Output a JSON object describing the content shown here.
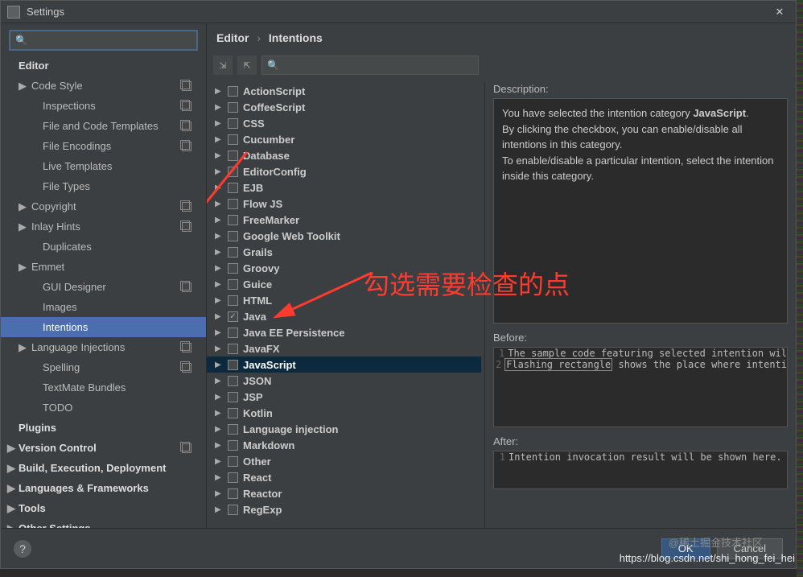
{
  "titlebar": {
    "title": "Settings"
  },
  "breadcrumb": {
    "a": "Editor",
    "b": "Intentions"
  },
  "sidebar": {
    "search_placeholder": "",
    "items": [
      {
        "label": "Editor",
        "lvl": 0,
        "bold": true,
        "arrow": ""
      },
      {
        "label": "Code Style",
        "lvl": 1,
        "arrow": "▶",
        "copy": true
      },
      {
        "label": "Inspections",
        "lvl": 2,
        "copy": true
      },
      {
        "label": "File and Code Templates",
        "lvl": 2,
        "copy": true
      },
      {
        "label": "File Encodings",
        "lvl": 2,
        "copy": true
      },
      {
        "label": "Live Templates",
        "lvl": 2
      },
      {
        "label": "File Types",
        "lvl": 2
      },
      {
        "label": "Copyright",
        "lvl": 1,
        "arrow": "▶",
        "copy": true
      },
      {
        "label": "Inlay Hints",
        "lvl": 1,
        "arrow": "▶",
        "copy": true
      },
      {
        "label": "Duplicates",
        "lvl": 2
      },
      {
        "label": "Emmet",
        "lvl": 1,
        "arrow": "▶"
      },
      {
        "label": "GUI Designer",
        "lvl": 2,
        "copy": true
      },
      {
        "label": "Images",
        "lvl": 2
      },
      {
        "label": "Intentions",
        "lvl": 2,
        "selected": true
      },
      {
        "label": "Language Injections",
        "lvl": 1,
        "arrow": "▶",
        "copy": true
      },
      {
        "label": "Spelling",
        "lvl": 2,
        "copy": true
      },
      {
        "label": "TextMate Bundles",
        "lvl": 2
      },
      {
        "label": "TODO",
        "lvl": 2
      },
      {
        "label": "Plugins",
        "lvl": 0,
        "bold": true
      },
      {
        "label": "Version Control",
        "lvl": 0,
        "bold": true,
        "arrow": "▶",
        "copy": true
      },
      {
        "label": "Build, Execution, Deployment",
        "lvl": 0,
        "bold": true,
        "arrow": "▶"
      },
      {
        "label": "Languages & Frameworks",
        "lvl": 0,
        "bold": true,
        "arrow": "▶"
      },
      {
        "label": "Tools",
        "lvl": 0,
        "bold": true,
        "arrow": "▶"
      },
      {
        "label": "Other Settings",
        "lvl": 0,
        "bold": true,
        "arrow": "▶"
      }
    ]
  },
  "intentions": [
    {
      "label": "ActionScript"
    },
    {
      "label": "CoffeeScript"
    },
    {
      "label": "CSS"
    },
    {
      "label": "Cucumber"
    },
    {
      "label": "Database"
    },
    {
      "label": "EditorConfig"
    },
    {
      "label": "EJB"
    },
    {
      "label": "Flow JS"
    },
    {
      "label": "FreeMarker"
    },
    {
      "label": "Google Web Toolkit"
    },
    {
      "label": "Grails"
    },
    {
      "label": "Groovy"
    },
    {
      "label": "Guice"
    },
    {
      "label": "HTML"
    },
    {
      "label": "Java",
      "checked": true
    },
    {
      "label": "Java EE Persistence"
    },
    {
      "label": "JavaFX"
    },
    {
      "label": "JavaScript",
      "sel": true
    },
    {
      "label": "JSON"
    },
    {
      "label": "JSP"
    },
    {
      "label": "Kotlin"
    },
    {
      "label": "Language injection"
    },
    {
      "label": "Markdown"
    },
    {
      "label": "Other"
    },
    {
      "label": "React"
    },
    {
      "label": "Reactor"
    },
    {
      "label": "RegExp"
    }
  ],
  "desc": {
    "label": "Description:",
    "line1a": "You have selected the intention category ",
    "line1b": "JavaScript",
    "line1c": ".",
    "line2": "By clicking the checkbox, you can enable/disable all intentions in this category.",
    "line3": "To enable/disable a particular intention, select the intention inside this category."
  },
  "before": {
    "label": "Before:",
    "l1": "The sample code featuring selected intention wil",
    "l2a": "Flashing rectangle",
    "l2b": " shows the place where intenti"
  },
  "after": {
    "label": "After:",
    "l1": "Intention invocation result will be shown here."
  },
  "footer": {
    "ok": "OK",
    "cancel": "Cancel"
  },
  "annotation": "勾选需要检查的点",
  "watermark1": "@稀土掘金技术社区",
  "watermark2": "https://blog.csdn.net/shi_hong_fei_hei"
}
